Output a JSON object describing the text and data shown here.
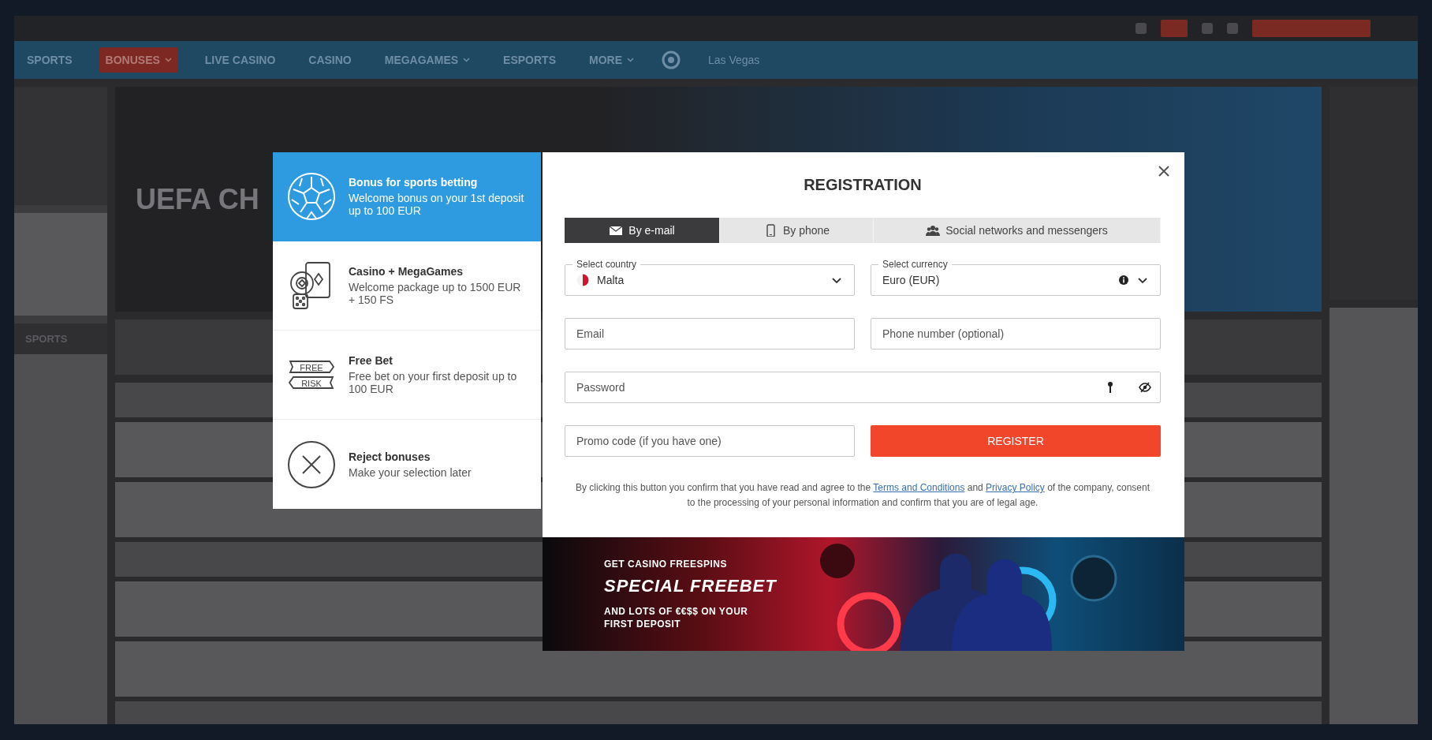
{
  "background": {
    "nav": [
      {
        "label": "SPORTS",
        "highlighted": false,
        "has_menu": false
      },
      {
        "label": "BONUSES",
        "highlighted": true,
        "has_menu": true
      },
      {
        "label": "LIVE CASINO",
        "highlighted": false,
        "has_menu": false
      },
      {
        "label": "CASINO",
        "highlighted": false,
        "has_menu": false
      },
      {
        "label": "MEGAGAMES",
        "highlighted": false,
        "has_menu": true
      },
      {
        "label": "ESPORTS",
        "highlighted": false,
        "has_menu": false
      },
      {
        "label": "MORE",
        "highlighted": false,
        "has_menu": true
      },
      {
        "label": "Las Vegas",
        "highlighted": false,
        "has_menu": false
      }
    ],
    "banner_title": "UEFA CH",
    "sidebar_heading": "SPORTS"
  },
  "bonus_options": [
    {
      "kind": "ball",
      "title": "Bonus for sports betting",
      "description": "Welcome bonus on your 1st deposit up to 100 EUR",
      "selected": true
    },
    {
      "kind": "casino",
      "title": "Casino + MegaGames",
      "description": "Welcome package up to 1500 EUR + 150 FS",
      "selected": false
    },
    {
      "kind": "ticket",
      "title": "Free Bet",
      "description": "Free bet on your first deposit up to 100 EUR",
      "selected": false,
      "icon_words": [
        "FREE",
        "RISK"
      ]
    },
    {
      "kind": "reject",
      "title": "Reject bonuses",
      "description": "Make your selection later",
      "selected": false
    }
  ],
  "registration": {
    "title": "REGISTRATION",
    "tabs": [
      {
        "label": "By e-mail",
        "selected": true
      },
      {
        "label": "By phone",
        "selected": false
      },
      {
        "label": "Social networks and messengers",
        "selected": false
      }
    ],
    "country": {
      "label": "Select country",
      "value": "Malta"
    },
    "currency": {
      "label": "Select currency",
      "value": "Euro (EUR)"
    },
    "email": {
      "placeholder": "Email"
    },
    "phone": {
      "placeholder": "Phone number (optional)"
    },
    "password": {
      "placeholder": "Password"
    },
    "promo": {
      "placeholder": "Promo code (if you have one)"
    },
    "submit": "REGISTER",
    "legal": {
      "before": "By clicking this button you confirm that you have read and agree to the",
      "terms": "Terms and Conditions",
      "middle": "and",
      "privacy": "Privacy Policy",
      "after": "of the company, consent to the processing of your personal information and confirm that you are of legal age."
    }
  },
  "promo_banner": {
    "lines": [
      {
        "kind": "small",
        "text": "GET CASINO FREESPINS"
      },
      {
        "kind": "big",
        "text": "SPECIAL FREEBET"
      },
      {
        "kind": "small",
        "text": "AND LOTS OF €€$$ ON YOUR"
      },
      {
        "kind": "small",
        "text": "FIRST DEPOSIT"
      }
    ]
  }
}
